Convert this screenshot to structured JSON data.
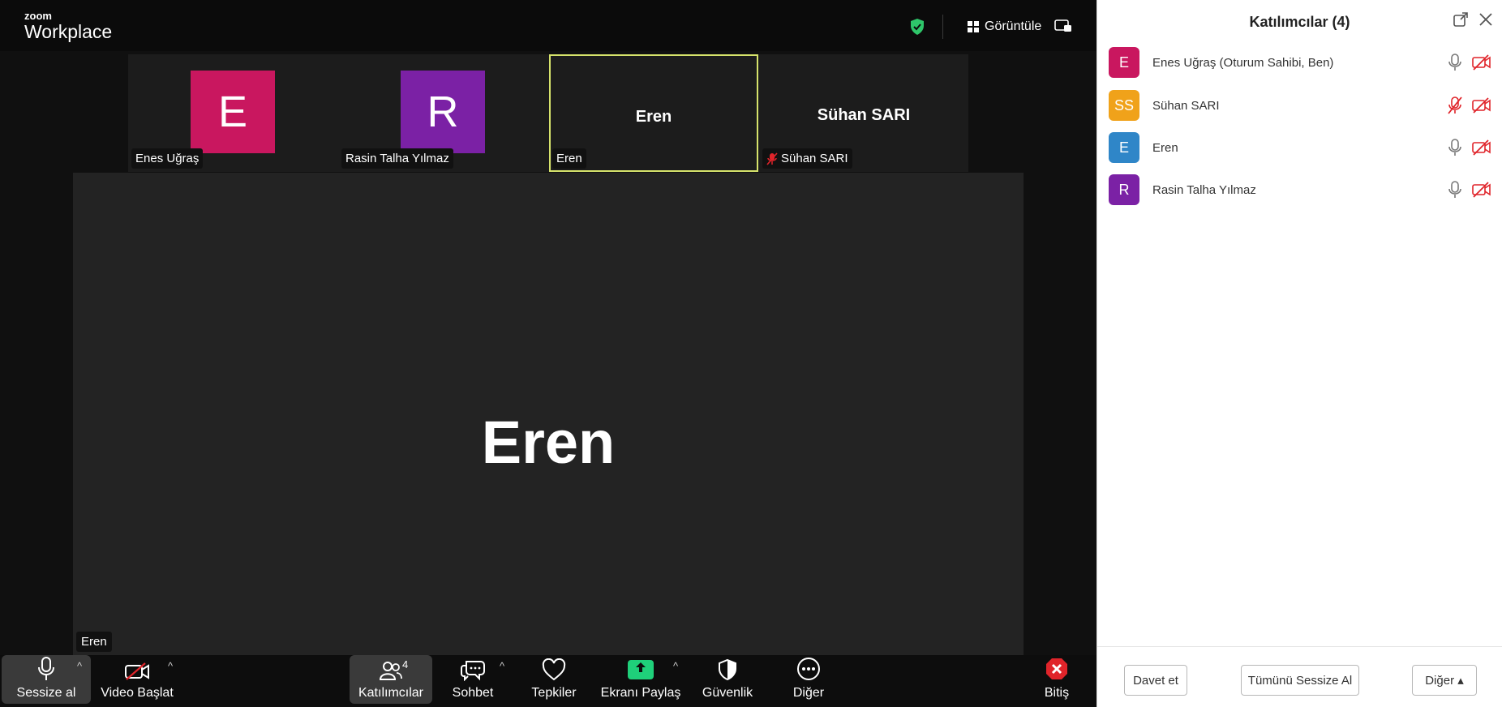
{
  "brand": {
    "small": "zoom",
    "big": "Workplace"
  },
  "topbar": {
    "view_label": "Görüntüle"
  },
  "tiles": [
    {
      "name": "Enes Uğraş",
      "initial": "E",
      "color": "#c9175f"
    },
    {
      "name": "Rasin Talha Yılmaz",
      "initial": "R",
      "color": "#7b21a5"
    },
    {
      "name": "Eren",
      "bigname": "Eren"
    },
    {
      "name": "Sühan SARI",
      "bigname": "Sühan SARI"
    }
  ],
  "main_video": {
    "name": "Eren",
    "label": "Eren"
  },
  "toolbar": {
    "mute": "Sessize al",
    "video": "Video Başlat",
    "participants": "Katılımcılar",
    "participants_count": "4",
    "chat": "Sohbet",
    "reactions": "Tepkiler",
    "share": "Ekranı Paylaş",
    "security": "Güvenlik",
    "more": "Diğer",
    "end": "Bitiş"
  },
  "panel": {
    "title": "Katılımcılar (4)",
    "participants": [
      {
        "initial": "E",
        "name": "Enes Uğraş (Oturum Sahibi, Ben)",
        "color": "#c9175f"
      },
      {
        "initial": "SS",
        "name": "Sühan SARI",
        "color": "#f0a21a"
      },
      {
        "initial": "E",
        "name": "Eren",
        "color": "#2f86c8"
      },
      {
        "initial": "R",
        "name": "Rasin Talha Yılmaz",
        "color": "#7b21a5"
      }
    ],
    "invite": "Davet et",
    "mute_all": "Tümünü Sessize Al",
    "more": "Diğer ▴"
  },
  "colors": {
    "accent_green": "#1fd07a",
    "muted_red": "#e0242a",
    "active_border": "#d6e36b"
  }
}
